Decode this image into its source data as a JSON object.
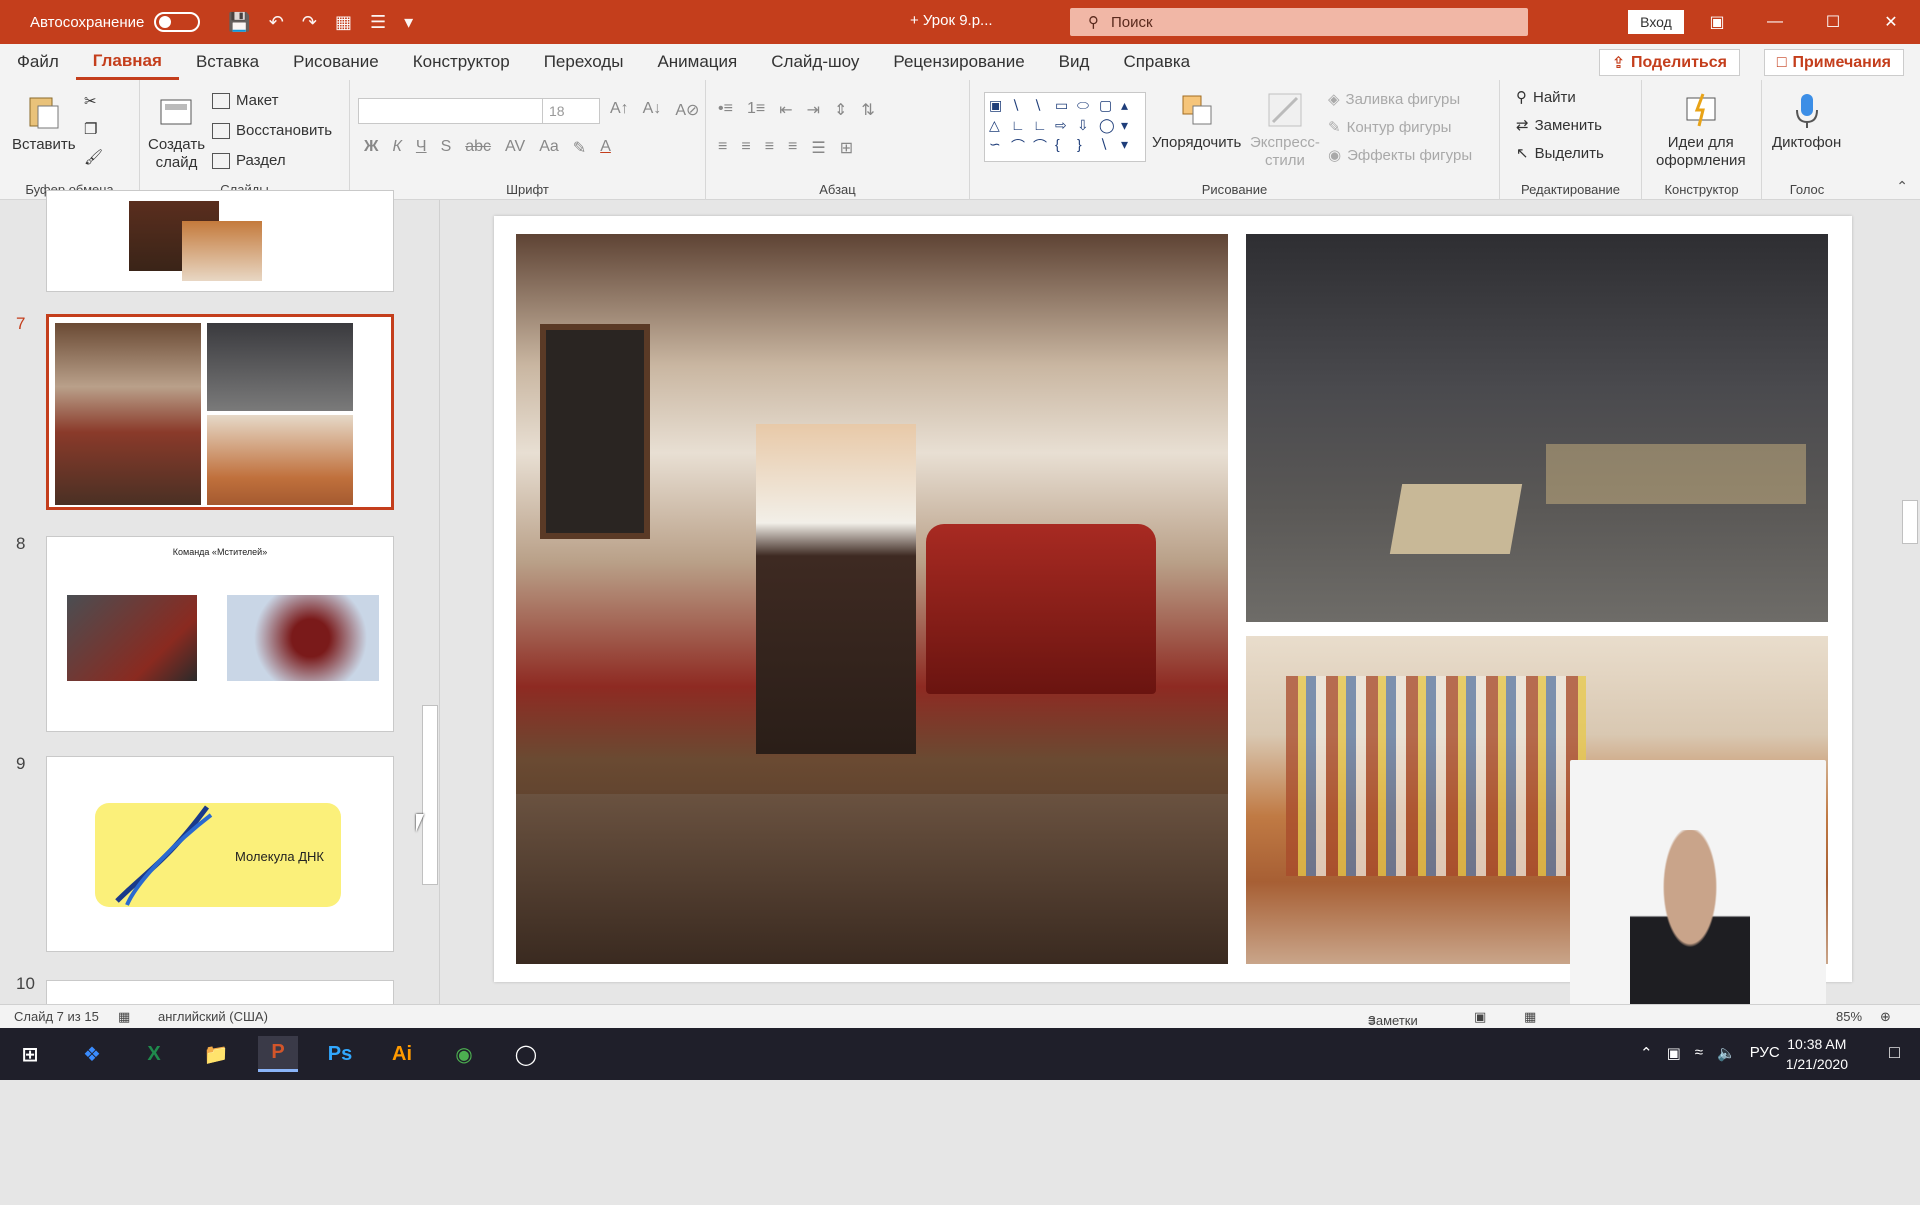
{
  "titlebar": {
    "autosave_label": "Автосохранение",
    "autosave_state": "Откл.",
    "doc_title": "+ Урок 9.р...",
    "search_placeholder": "Поиск",
    "login": "Вход"
  },
  "menu": {
    "tabs": [
      "Файл",
      "Главная",
      "Вставка",
      "Рисование",
      "Конструктор",
      "Переходы",
      "Анимация",
      "Слайд-шоу",
      "Рецензирование",
      "Вид",
      "Справка"
    ],
    "active_index": 1,
    "share": "Поделиться",
    "comments": "Примечания"
  },
  "ribbon": {
    "clipboard": {
      "paste": "Вставить",
      "label": "Буфер обмена"
    },
    "slides": {
      "new_slide_line1": "Создать",
      "new_slide_line2": "слайд",
      "layout": "Макет",
      "reset": "Восстановить",
      "section": "Раздел",
      "label": "Слайды"
    },
    "font": {
      "size": "18",
      "label": "Шрифт"
    },
    "paragraph": {
      "label": "Абзац"
    },
    "drawing": {
      "arrange": "Упорядочить",
      "quick_styles_line1": "Экспресс-",
      "quick_styles_line2": "стили",
      "fill": "Заливка фигуры",
      "outline": "Контур фигуры",
      "effects": "Эффекты фигуры",
      "label": "Рисование"
    },
    "editing": {
      "find": "Найти",
      "replace": "Заменить",
      "select": "Выделить",
      "label": "Редактирование"
    },
    "designer": {
      "ideas_line1": "Идеи для",
      "ideas_line2": "оформления",
      "label": "Конструктор"
    },
    "voice": {
      "dictate": "Диктофон",
      "label": "Голос"
    }
  },
  "slides_pane": {
    "numbers": [
      "7",
      "8",
      "9",
      "10"
    ],
    "selected": "7",
    "slide8_title": "Команда «Мстителей»",
    "slide9_text": "Молекула ДНК"
  },
  "status": {
    "slide_info": "Слайд 7 из 15",
    "language": "английский (США)",
    "notes": "Заметки",
    "zoom": "85%"
  },
  "taskbar": {
    "apps": [
      "start",
      "dropbox",
      "excel",
      "explorer",
      "powerpoint",
      "photoshop",
      "illustrator",
      "chrome",
      "obs"
    ],
    "active": "powerpoint",
    "lang": "РУС",
    "time": "10:38 AM",
    "date": "1/21/2020"
  },
  "colors": {
    "accent": "#c43e1c"
  }
}
